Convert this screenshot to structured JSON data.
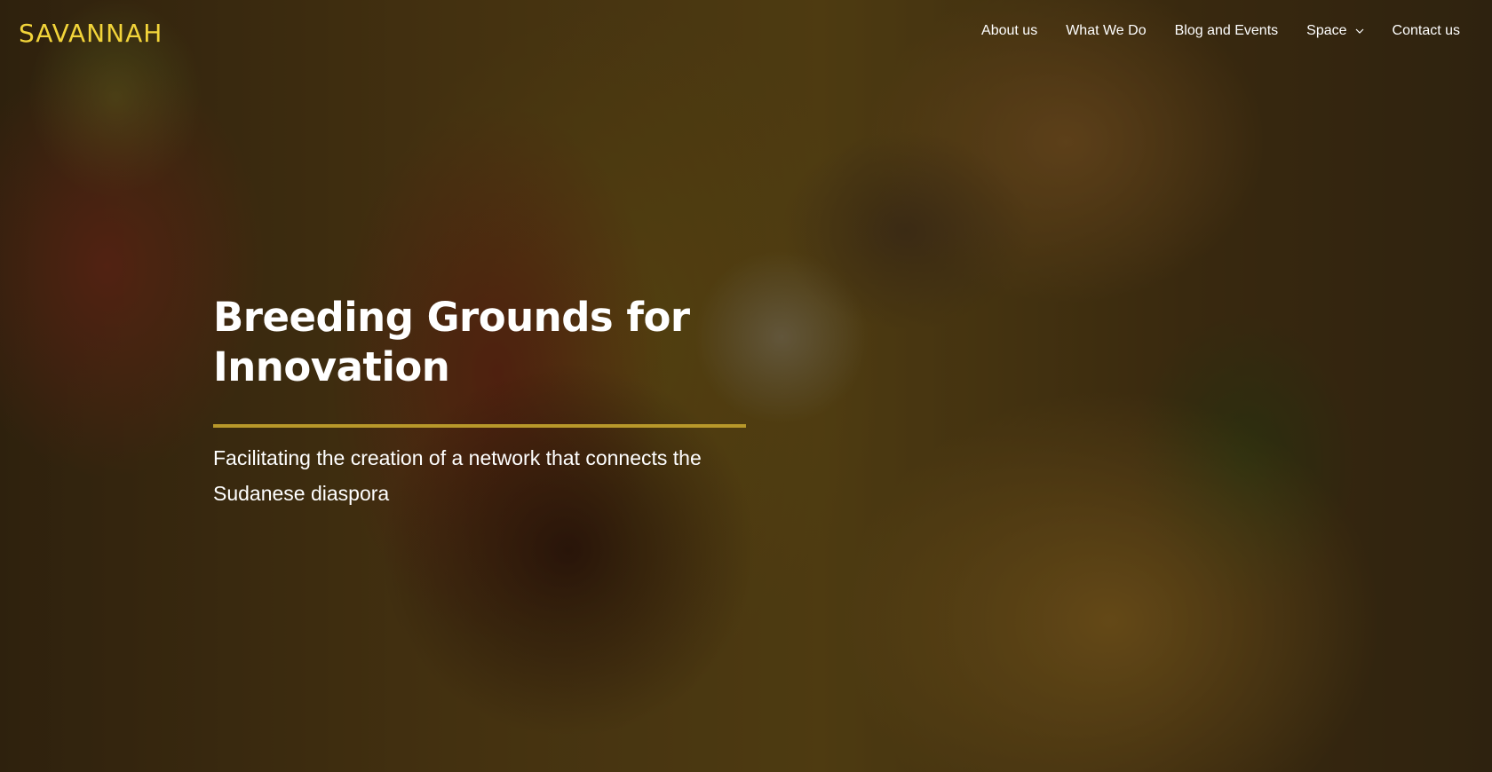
{
  "brand": {
    "logo_text": "SAVANNAH",
    "logo_color": "#f2d43a"
  },
  "nav": {
    "items": [
      {
        "label": "About us"
      },
      {
        "label": "What We Do"
      },
      {
        "label": "Blog and Events"
      },
      {
        "label": "Space",
        "icon": "chevron-down-icon"
      },
      {
        "label": "Contact us"
      }
    ]
  },
  "hero": {
    "title": "Breeding Grounds for Innovation",
    "subtitle": "Facilitating the creation of a network that connects the Sudanese diaspora",
    "accent_color": "#b8982a"
  }
}
